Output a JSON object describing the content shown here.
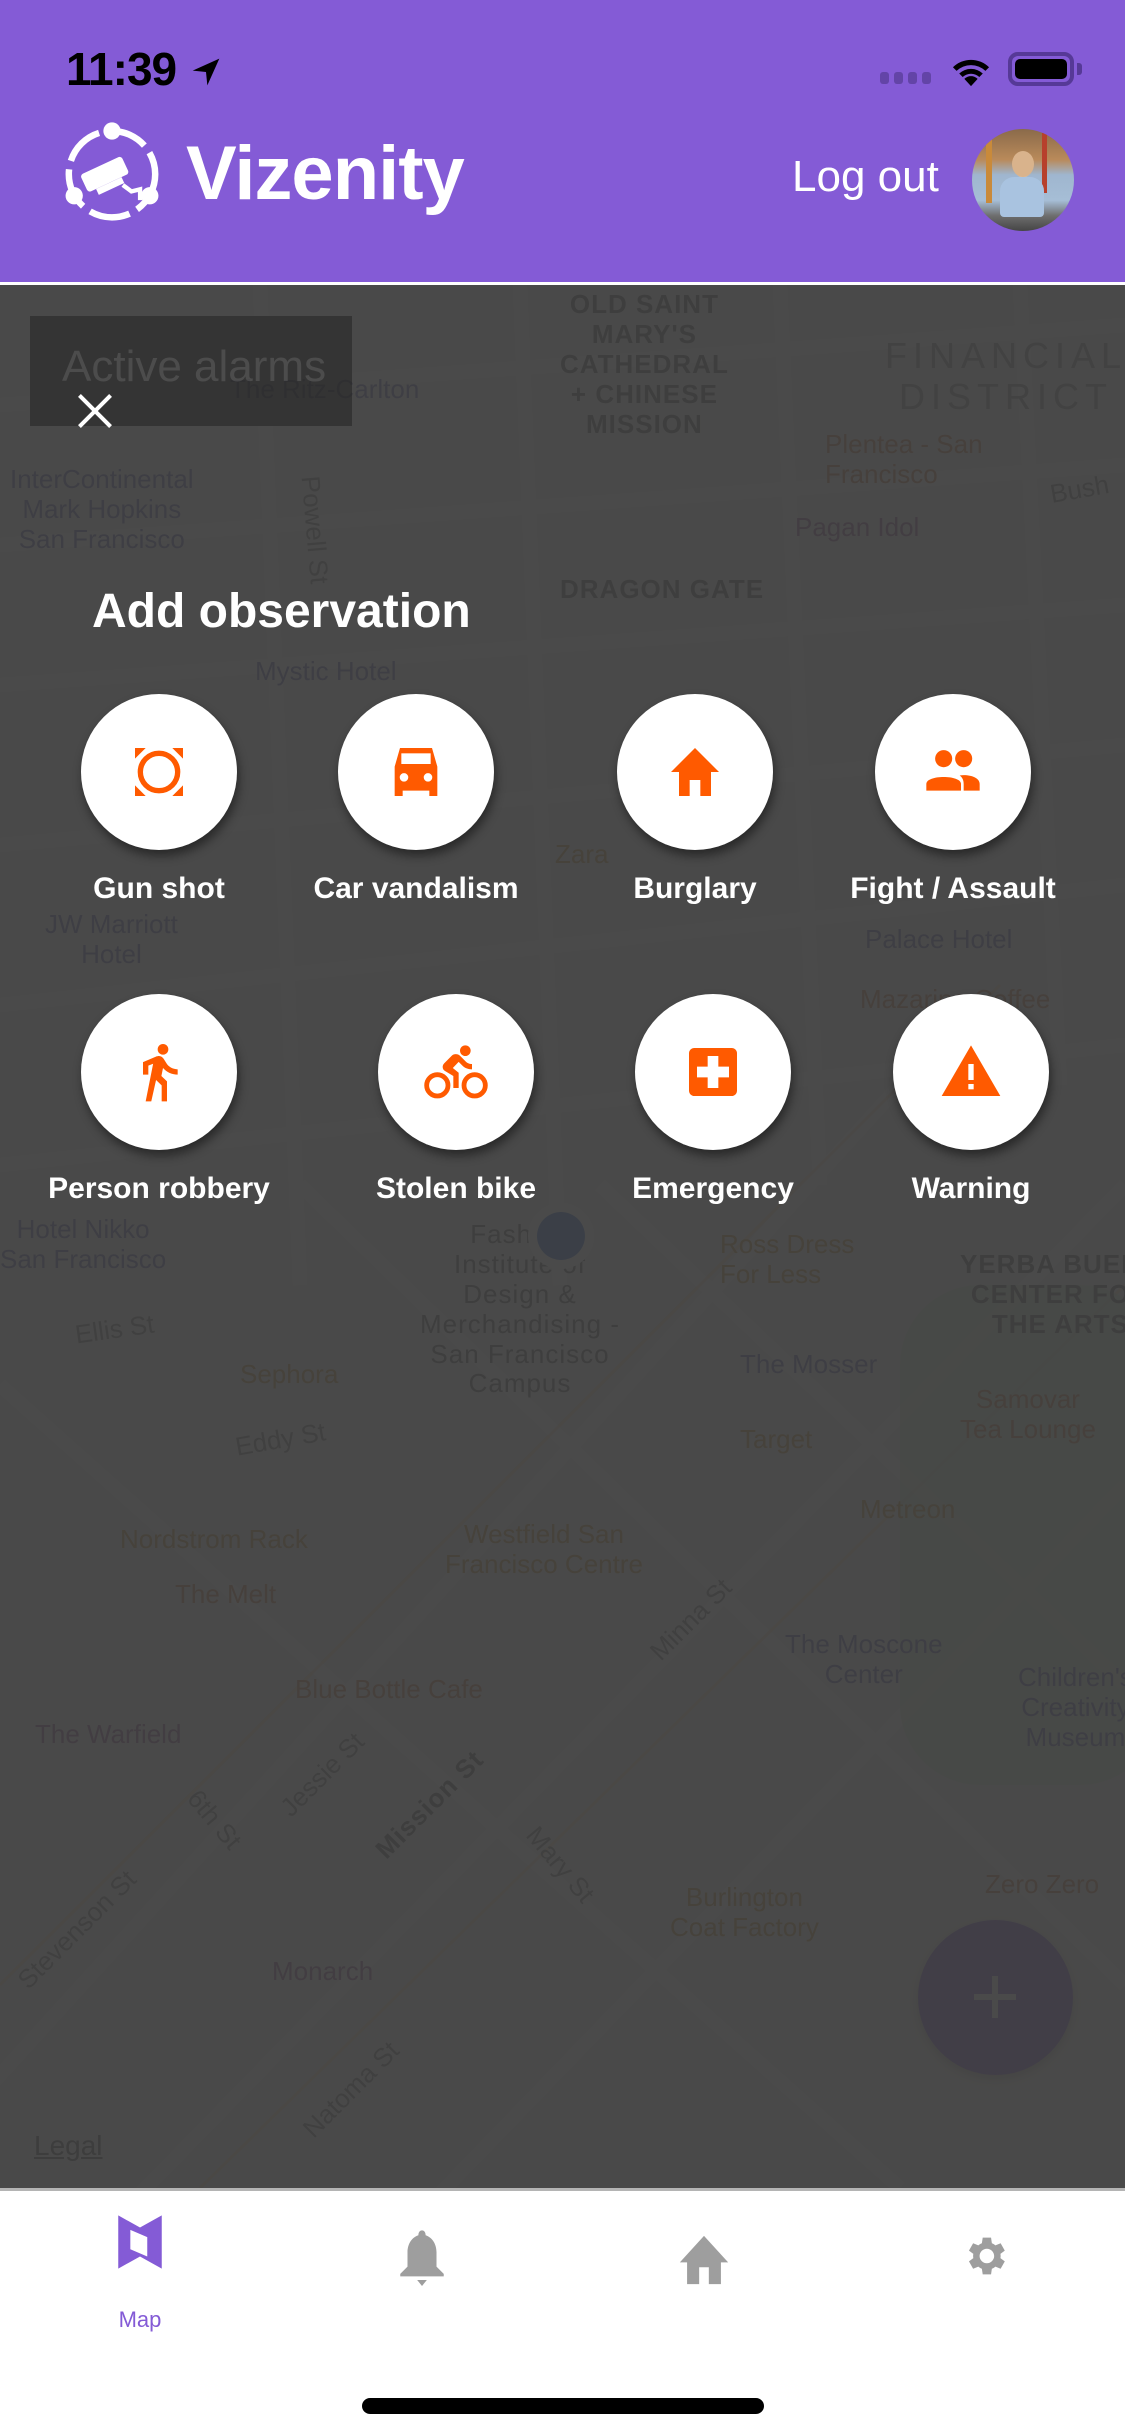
{
  "status_bar": {
    "time": "11:39",
    "location_icon": "location-arrow-icon",
    "signal_icon": "cellular-signal-icon",
    "wifi_icon": "wifi-icon",
    "battery_icon": "battery-full-icon"
  },
  "header": {
    "logo_icon": "camera-network-logo-icon",
    "brand": "Vizenity",
    "logout_label": "Log out",
    "avatar_alt": "User avatar",
    "background_color": "#845BD6"
  },
  "map": {
    "labels": [
      {
        "text": "InterContinental\nMark Hopkins\nSan Francisco",
        "kind": "hotel"
      },
      {
        "text": "The Ritz-Carlton",
        "kind": "hotel"
      },
      {
        "text": "OLD SAINT\nMARY'S\nCATHEDRAL\n+ CHINESE\nMISSION",
        "kind": "landmark"
      },
      {
        "text": "FINANCIAL\nDISTRICT",
        "kind": "district"
      },
      {
        "text": "Plentea - San\nFrancisco",
        "kind": "food"
      },
      {
        "text": "Pagan Idol",
        "kind": "bar"
      },
      {
        "text": "DRAGON GATE",
        "kind": "landmark"
      },
      {
        "text": "Mystic Hotel",
        "kind": "hotel"
      },
      {
        "text": "Bush",
        "kind": "street"
      },
      {
        "text": "Powell St",
        "kind": "street"
      },
      {
        "text": "Palace Hotel",
        "kind": "hotel"
      },
      {
        "text": "Mazarine Coffee",
        "kind": "food"
      },
      {
        "text": "JW Marriott\nHotel",
        "kind": "hotel"
      },
      {
        "text": "Hotel Nikko\nSan Francisco",
        "kind": "hotel"
      },
      {
        "text": "Fashion\nInstitute of\nDesign &\nMerchandising -\nSan Francisco\nCampus",
        "kind": "landmark"
      },
      {
        "text": "Ross Dress\nFor Less",
        "kind": "shop"
      },
      {
        "text": "YERBA BUENA\nCENTER FOR\nTHE ARTS",
        "kind": "landmark"
      },
      {
        "text": "The Mosser",
        "kind": "hotel"
      },
      {
        "text": "Ellis St",
        "kind": "street"
      },
      {
        "text": "Sephora",
        "kind": "shop"
      },
      {
        "text": "Eddy St",
        "kind": "street"
      },
      {
        "text": "Target",
        "kind": "shop"
      },
      {
        "text": "Samovar\nTea Lounge",
        "kind": "food"
      },
      {
        "text": "Metreon",
        "kind": "shop"
      },
      {
        "text": "Nordstrom Rack",
        "kind": "shop"
      },
      {
        "text": "Westfield San\nFrancisco Centre",
        "kind": "shop"
      },
      {
        "text": "The Melt",
        "kind": "food"
      },
      {
        "text": "The Moscone\nCenter",
        "kind": "landmark"
      },
      {
        "text": "Children's\nCreativity\nMuseum",
        "kind": "landmark"
      },
      {
        "text": "Blue Bottle Cafe",
        "kind": "food"
      },
      {
        "text": "The Warfield",
        "kind": "bar"
      },
      {
        "text": "Mission St",
        "kind": "street"
      },
      {
        "text": "Jessie St",
        "kind": "street"
      },
      {
        "text": "6th St",
        "kind": "street"
      },
      {
        "text": "Mary St",
        "kind": "street"
      },
      {
        "text": "Minna St",
        "kind": "street"
      },
      {
        "text": "Stevenson St",
        "kind": "street"
      },
      {
        "text": "Natoma St",
        "kind": "street"
      },
      {
        "text": "Monarch",
        "kind": "bar"
      },
      {
        "text": "Burlington\nCoat Factory",
        "kind": "shop"
      },
      {
        "text": "Zero Zero",
        "kind": "food"
      },
      {
        "text": "Zara",
        "kind": "shop"
      }
    ],
    "legal_link": "Legal",
    "fab_icon": "plus-icon"
  },
  "overlay": {
    "active_alarms_label": "Active alarms",
    "close_icon": "close-icon",
    "title": "Add observation",
    "accent_color": "#FF5A00",
    "observations": [
      {
        "label": "Gun shot",
        "icon": "gunshot-target-icon"
      },
      {
        "label": "Car vandalism",
        "icon": "car-icon"
      },
      {
        "label": "Burglary",
        "icon": "house-icon"
      },
      {
        "label": "Fight / Assault",
        "icon": "people-icon"
      },
      {
        "label": "Person robbery",
        "icon": "running-person-icon"
      },
      {
        "label": "Stolen bike",
        "icon": "bicycle-icon"
      },
      {
        "label": "Emergency",
        "icon": "medical-cross-icon"
      },
      {
        "label": "Warning",
        "icon": "warning-triangle-icon"
      }
    ]
  },
  "tabbar": {
    "tabs": [
      {
        "label": "Map",
        "icon": "map-icon",
        "active": true
      },
      {
        "label": "",
        "icon": "bell-icon",
        "active": false
      },
      {
        "label": "",
        "icon": "home-icon",
        "active": false
      },
      {
        "label": "",
        "icon": "gear-icon",
        "active": false
      }
    ],
    "active_color": "#845BD6",
    "inactive_color": "#9E9E9E"
  }
}
